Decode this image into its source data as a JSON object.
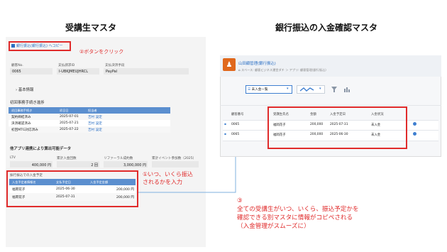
{
  "titles": {
    "left": "受講生マスタ",
    "right": "銀行振込の入金確認マスタ"
  },
  "left": {
    "copy_link": "銀行振込(銀行振込) へコピー",
    "field_labels": [
      "顧客No.",
      "支払請求ID",
      "支払決済手段"
    ],
    "field_values": [
      "0065",
      "I-UBKJMEUJHRCL",
      "PayPal"
    ],
    "basic_info": "基本情報",
    "procedure_section": "初回事務手続き進捗",
    "proc_headers": [
      "初回事務手続き",
      "初日日",
      "担当者"
    ],
    "proc_rows": [
      [
        "契約締結済み",
        "2025-07-01",
        "吉村 設定"
      ],
      [
        "決済確認済み",
        "2025-07-21",
        "吉村 設定"
      ],
      [
        "初回MTG対応済み",
        "2025-07-22",
        "吉村 設定"
      ]
    ],
    "data_section": "他アプリ連携により算出可能データ",
    "stat_labels": [
      "LTV",
      "累計入金回数",
      "リファーラル成約数",
      "累計イベント参加数（2025）"
    ],
    "stat_values": [
      "400,000 円",
      "2 回",
      "3,000,000 円",
      ""
    ],
    "sched_title": "振行振込での入金予定",
    "sched_headers": [
      "入金予定者情報名",
      "支払予定日",
      "入金予定金額"
    ],
    "sched_rows": [
      [
        "福岡花子",
        "2025-06-30",
        "200,000 円"
      ],
      [
        "福岡花子",
        "2025-07-31",
        "200,000 円"
      ]
    ]
  },
  "annotations": {
    "a2": "②ボタンをクリック",
    "a1_line1": "①いつ、いくら振込",
    "a1_line2": "されるかを入力",
    "a3_lines": [
      "③",
      "全ての受講生がいつ、いくら、振込予定かを",
      "確認できる別マスタに情報がコピペされる",
      "（入金管理がスムーズに）"
    ]
  },
  "right": {
    "app_name": "山田顧管理(銀行振込)",
    "breadcrumb": "スペース: 顧客ビジネス運営ダチ ＞ アプリ: 顧客管理(銀行振込)",
    "view_select": "未入金一覧",
    "headers": [
      "顧客番号",
      "受講生氏名",
      "金額",
      "入金予定日",
      "入金状況"
    ],
    "rows": [
      [
        "0065",
        "福岡花子",
        "200,000",
        "2025-07-31",
        "未入金"
      ],
      [
        "0065",
        "福岡花子",
        "200,000",
        "2025-06-30",
        "未入金"
      ]
    ]
  },
  "colors": {
    "accent_red": "#e02b2b",
    "table_header_blue": "#5b8fcf",
    "app_orange": "#e0681c"
  }
}
